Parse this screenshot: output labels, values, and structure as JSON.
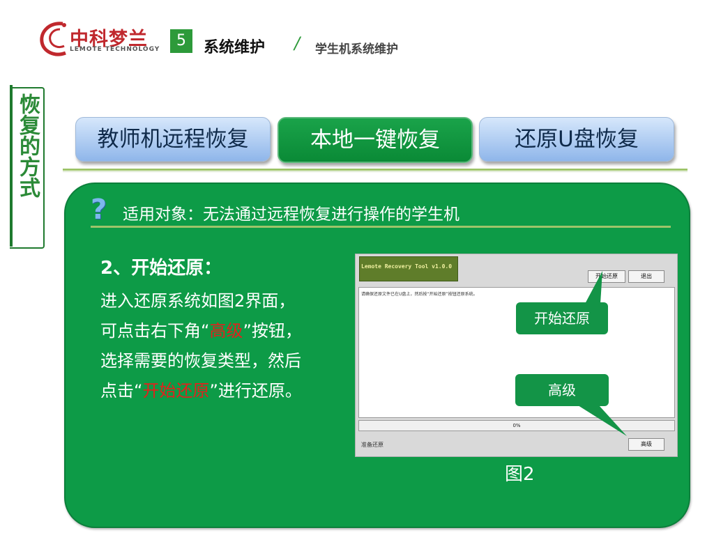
{
  "header": {
    "logo_cn": "中科梦兰",
    "logo_en": "LEMOTE TECHNOLOGY",
    "section_number": "5",
    "section_title": "系统维护",
    "separator": "/",
    "subsection": "学生机系统维护"
  },
  "side_label": "恢复的方式",
  "tabs": [
    {
      "label": "教师机远程恢复"
    },
    {
      "label": "本地一键恢复"
    },
    {
      "label": "还原U盘恢复"
    }
  ],
  "panel": {
    "applies_to": "适用对象：无法通过远程恢复进行操作的学生机",
    "step_title": "2、开始还原：",
    "line1": "进入还原系统如图2界面，",
    "line2_pre": "可点击右下角“",
    "line2_em": "高级",
    "line2_post": "”按钮，",
    "line3": "选择需要的恢复类型，然后",
    "line4_pre": "点击“",
    "line4_em": "开始还原",
    "line4_post": "”进行还原。",
    "figure_caption": "图2"
  },
  "tool": {
    "title": "Lemote Recovery Tool v1.0.0",
    "start_button": "开始还原",
    "exit_button": "退出",
    "message": "请确保还原文件已在U盘上，然后按“开始还原”按钮还原系统。",
    "progress": "0%",
    "progress_value": 0,
    "status": "准备还原",
    "advanced_button": "高级"
  },
  "callouts": {
    "start": "开始还原",
    "advanced": "高级"
  },
  "colors": {
    "panel_green": "#0d9b47",
    "tab_blue": "#8fb6ea",
    "accent_red": "#e3201c",
    "logo_red": "#c0282d"
  }
}
